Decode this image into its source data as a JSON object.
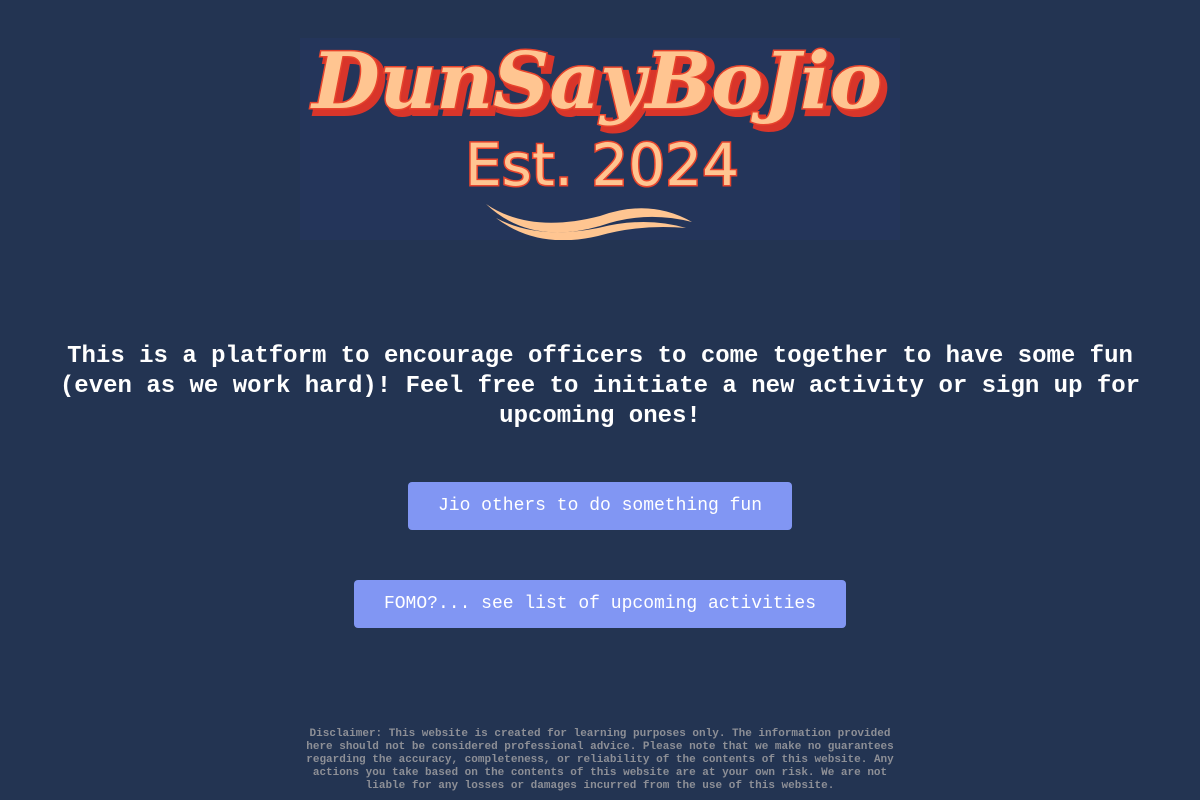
{
  "logo": {
    "title": "DunSayBoJio",
    "subtitle": "Est. 2024",
    "colors": {
      "fill": "#ffc591",
      "outline": "#e8442c",
      "shadow": "#d8352a",
      "background": "#24355a"
    }
  },
  "tagline": "This is a platform to encourage officers to come together to have some fun (even as we work hard)! Feel free to initiate a new activity or sign up for upcoming ones!",
  "buttons": {
    "jio": "Jio others to do something fun",
    "fomo": "FOMO?... see list of upcoming activities"
  },
  "disclaimer": "Disclaimer: This website is created for learning purposes only. The information provided here should not be considered professional advice. Please note that we make no guarantees regarding the accuracy, completeness, or reliability of the contents of this website. Any actions you take based on the contents of this website are at your own risk. We are not liable for any losses or damages incurred from the use of this website.",
  "theme": {
    "page_background": "#233452",
    "button_background": "#8196f3",
    "text": "#ffffff",
    "disclaimer_text": "#8d8f96"
  }
}
